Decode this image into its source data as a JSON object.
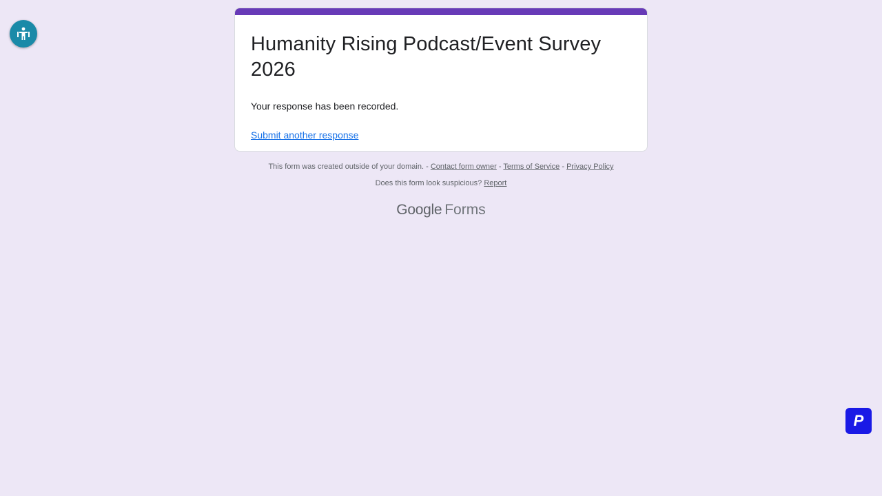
{
  "colors": {
    "background": "#ede7f6",
    "accent": "#673ab7",
    "link": "#1a73e8",
    "accessibility_button": "#1a8aa8",
    "p_button": "#1a1ae6"
  },
  "accessibility": {
    "icon": "accessibility-icon"
  },
  "form": {
    "title": "Humanity Rising Podcast/Event Survey 2026",
    "confirmation": "Your response has been recorded.",
    "another_link": "Submit another response"
  },
  "footer": {
    "domain_note": "This form was created outside of your domain. - ",
    "contact_link": "Contact form owner",
    "sep1": " - ",
    "terms_link": "Terms of Service",
    "sep2": " - ",
    "privacy_link": "Privacy Policy",
    "suspicious_text": "Does this form look suspicious? ",
    "report_link": "Report"
  },
  "logo": {
    "google": "Google",
    "forms": "Forms"
  },
  "extension": {
    "label": "P",
    "icon": "p-logo-icon"
  }
}
